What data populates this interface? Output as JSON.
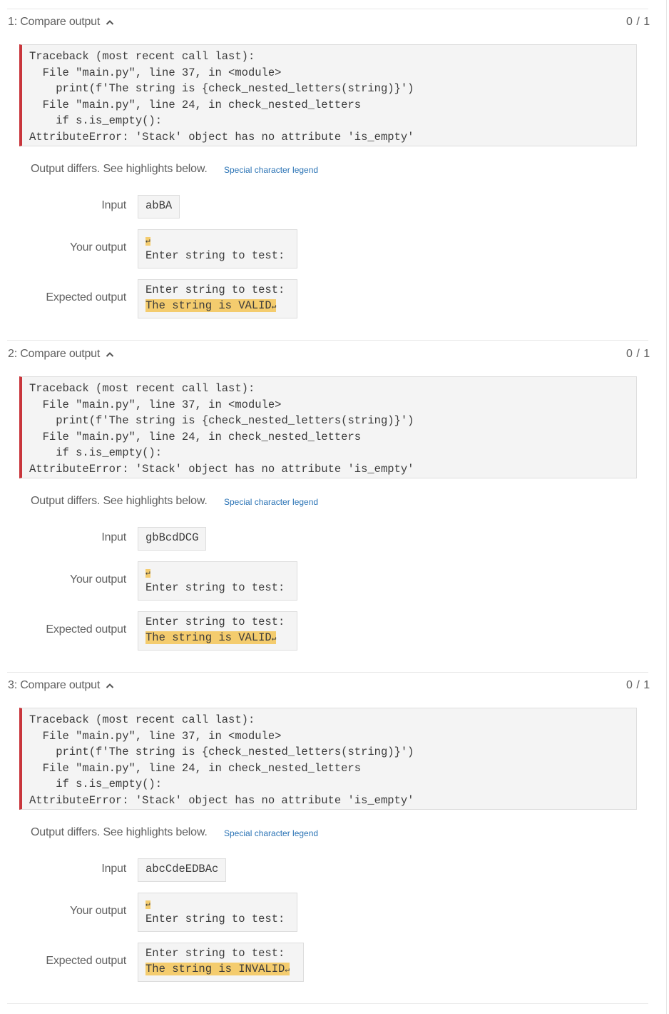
{
  "sections": [
    {
      "title": "1: Compare output",
      "score": "0 / 1",
      "traceback": "Traceback (most recent call last):\n  File \"main.py\", line 37, in <module>\n    print(f'The string is {check_nested_letters(string)}')\n  File \"main.py\", line 24, in check_nested_letters\n    if s.is_empty():\nAttributeError: 'Stack' object has no attribute 'is_empty'",
      "diff_message": "Output differs. See highlights below.",
      "legend_link": "Special character legend",
      "input_label": "Input",
      "input_value": "abBA",
      "your_output_label": "Your output",
      "your_output_line2": "Enter string to test:",
      "expected_label": "Expected output",
      "expected_line1": "Enter string to test:",
      "expected_line2": "The string is VALID"
    },
    {
      "title": "2: Compare output",
      "score": "0 / 1",
      "traceback": "Traceback (most recent call last):\n  File \"main.py\", line 37, in <module>\n    print(f'The string is {check_nested_letters(string)}')\n  File \"main.py\", line 24, in check_nested_letters\n    if s.is_empty():\nAttributeError: 'Stack' object has no attribute 'is_empty'",
      "diff_message": "Output differs. See highlights below.",
      "legend_link": "Special character legend",
      "input_label": "Input",
      "input_value": "gbBcdDCG",
      "your_output_label": "Your output",
      "your_output_line2": "Enter string to test:",
      "expected_label": "Expected output",
      "expected_line1": "Enter string to test:",
      "expected_line2": "The string is VALID"
    },
    {
      "title": "3: Compare output",
      "score": "0 / 1",
      "traceback": "Traceback (most recent call last):\n  File \"main.py\", line 37, in <module>\n    print(f'The string is {check_nested_letters(string)}')\n  File \"main.py\", line 24, in check_nested_letters\n    if s.is_empty():\nAttributeError: 'Stack' object has no attribute 'is_empty'",
      "diff_message": "Output differs. See highlights below.",
      "legend_link": "Special character legend",
      "input_label": "Input",
      "input_value": "abcCdeEDBAc",
      "your_output_label": "Your output",
      "your_output_line2": "Enter string to test:",
      "expected_label": "Expected output",
      "expected_line1": "Enter string to test:",
      "expected_line2": "The string is INVALID"
    }
  ],
  "newline_symbol": "↵",
  "colors": {
    "error_border": "#c8353b",
    "highlight": "#f4cc6e",
    "link": "#2a73b5"
  },
  "icons": {
    "collapse": "chevron-up-icon"
  }
}
